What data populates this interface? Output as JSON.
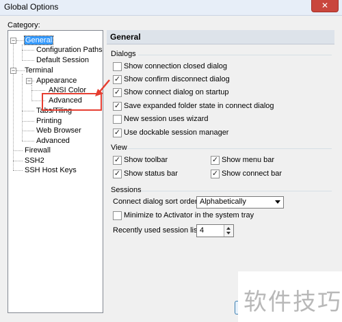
{
  "window": {
    "title": "Global Options",
    "close_glyph": "✕"
  },
  "category_label": "Category:",
  "tree": {
    "general": "General",
    "configuration_paths": "Configuration Paths",
    "default_session": "Default Session",
    "terminal": "Terminal",
    "appearance": "Appearance",
    "ansi_color": "ANSI Color",
    "appearance_advanced": "Advanced",
    "tabs_tiling": "Tabs/Tiling",
    "printing": "Printing",
    "web_browser": "Web Browser",
    "terminal_advanced": "Advanced",
    "firewall": "Firewall",
    "ssh2": "SSH2",
    "ssh_host_keys": "SSH Host Keys",
    "expander_glyph": "−"
  },
  "panel_title": "General",
  "dialogs": {
    "title": "Dialogs",
    "items": [
      {
        "label": "Show connection closed dialog",
        "checked": false
      },
      {
        "label": "Show confirm disconnect dialog",
        "checked": true
      },
      {
        "label": "Show connect dialog on startup",
        "checked": true
      },
      {
        "label": "Save expanded folder state in connect dialog",
        "checked": true
      },
      {
        "label": "New session uses wizard",
        "checked": false
      },
      {
        "label": "Use dockable session manager",
        "checked": true
      }
    ]
  },
  "view": {
    "title": "View",
    "show_toolbar": {
      "label": "Show toolbar",
      "checked": true
    },
    "show_status_bar": {
      "label": "Show status bar",
      "checked": true
    },
    "show_menu_bar": {
      "label": "Show menu bar",
      "checked": true
    },
    "show_connect_bar": {
      "label": "Show connect bar",
      "checked": true
    }
  },
  "sessions": {
    "title": "Sessions",
    "sort_order_label": "Connect dialog sort order:",
    "sort_order_value": "Alphabetically",
    "minimize_label": "Minimize to Activator in the system tray",
    "minimize_checked": false,
    "recent_label": "Recently used session list:",
    "recent_value": "4"
  },
  "watermark": "软件技巧",
  "colors": {
    "annotation": "#e63e31",
    "selection": "#3399ff"
  },
  "check_glyph": "✓"
}
